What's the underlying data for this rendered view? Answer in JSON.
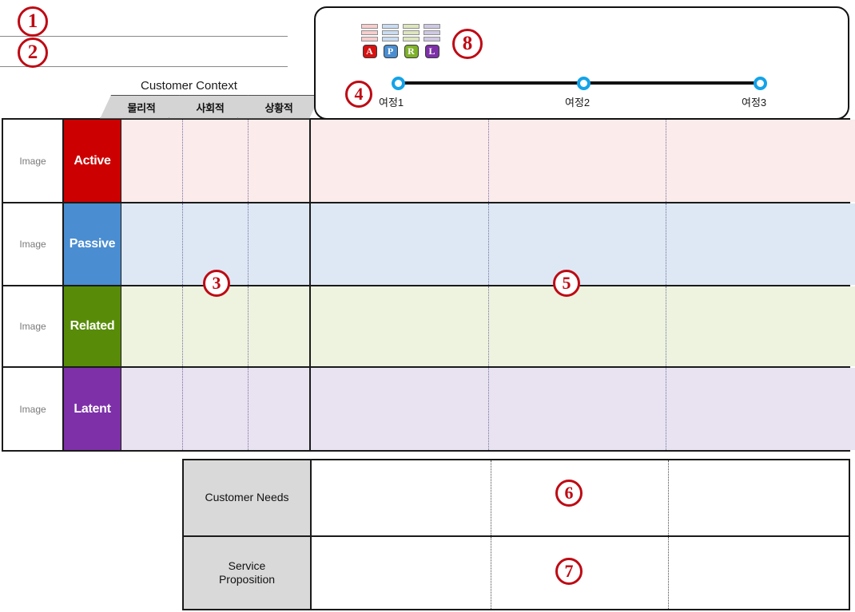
{
  "callouts": [
    {
      "id": "1",
      "label": "1"
    },
    {
      "id": "2",
      "label": "2"
    },
    {
      "id": "3",
      "label": "3"
    },
    {
      "id": "4",
      "label": "4"
    },
    {
      "id": "5",
      "label": "5"
    },
    {
      "id": "6",
      "label": "6"
    },
    {
      "id": "7",
      "label": "7"
    },
    {
      "id": "8",
      "label": "8"
    }
  ],
  "customer_context": {
    "title": "Customer Context",
    "tabs": [
      {
        "label": "물리적"
      },
      {
        "label": "사회적"
      },
      {
        "label": "상황적"
      }
    ]
  },
  "matrix": {
    "image_cell_label": "Image",
    "rows": [
      {
        "label": "Active",
        "label_color": "#CC0000",
        "tint": "#FCEBEB"
      },
      {
        "label": "Passive",
        "label_color": "#4A8DD0",
        "tint": "#DDE8F4"
      },
      {
        "label": "Related",
        "label_color": "#588C08",
        "tint": "#EDF3DF"
      },
      {
        "label": "Latent",
        "label_color": "#7D30A8",
        "tint": "#E9E3F1"
      }
    ]
  },
  "journey": {
    "nodes": [
      {
        "label": "여정1"
      },
      {
        "label": "여정2"
      },
      {
        "label": "여정3"
      }
    ],
    "node_ring_color": "#14A3E8",
    "connector_color": "#111111"
  },
  "legend": {
    "columns": [
      {
        "badge": "A",
        "badge_color": "#D51212",
        "bar_color": "#F8CDCD"
      },
      {
        "badge": "P",
        "badge_color": "#4A8DD0",
        "bar_color": "#C9DCF2"
      },
      {
        "badge": "R",
        "badge_color": "#7FB229",
        "bar_color": "#DCE6BC"
      },
      {
        "badge": "L",
        "badge_color": "#7D30A8",
        "bar_color": "#CFC8E4"
      }
    ],
    "bars_per_column": 3
  },
  "bottom_table": {
    "rows": [
      {
        "header": "Customer Needs"
      },
      {
        "header": "Service\nProposition"
      }
    ]
  }
}
